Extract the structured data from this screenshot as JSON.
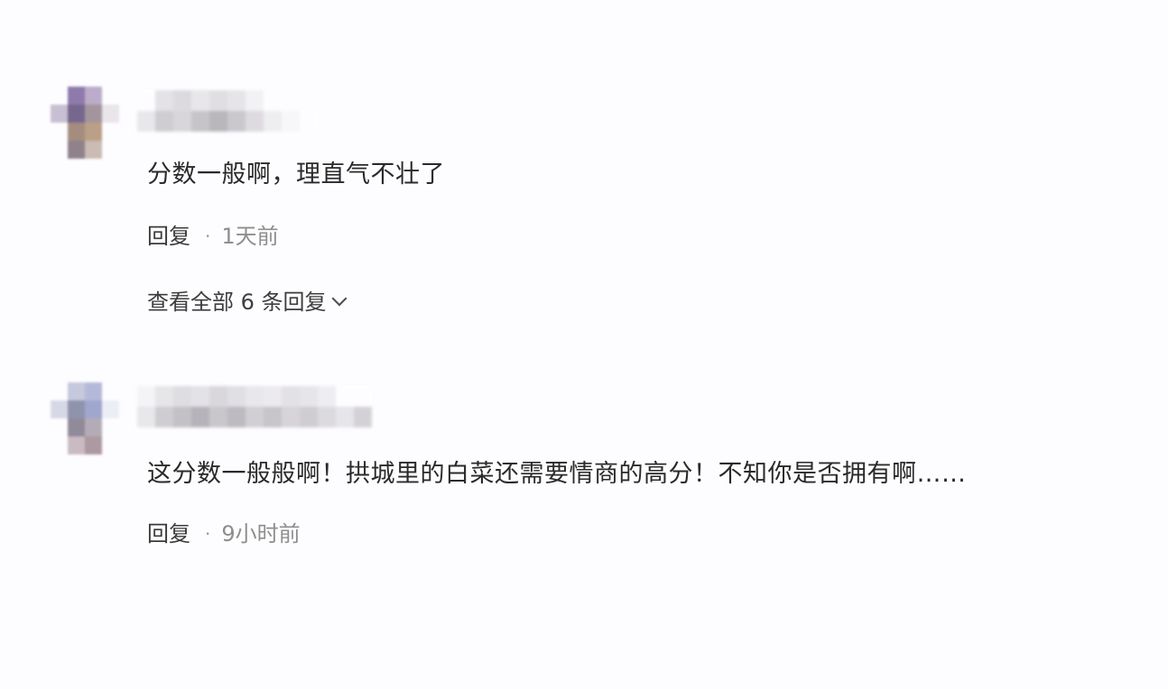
{
  "comments": [
    {
      "text": "分数一般啊，理直气不壮了",
      "reply_label": "回复",
      "separator": "·",
      "time": "1天前",
      "view_replies": "查看全部 6 条回复"
    },
    {
      "text": "这分数一般般啊！拱城里的白菜还需要情商的高分！不知你是否拥有啊……",
      "reply_label": "回复",
      "separator": "·",
      "time": "9小时前"
    }
  ],
  "colors": {
    "background": "#fdfdff",
    "text": "#2a2a2a",
    "muted": "#8e8e8e"
  },
  "icons": {
    "view_replies": "chevron-down-icon"
  }
}
